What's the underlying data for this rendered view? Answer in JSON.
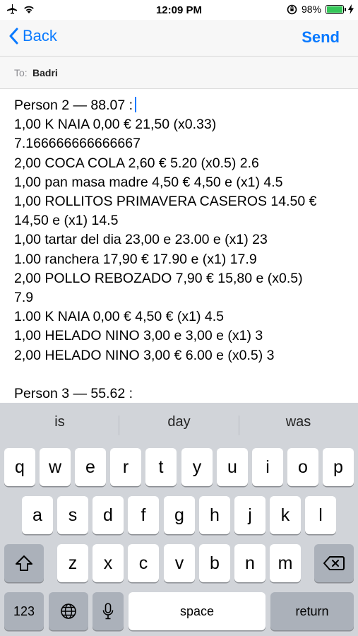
{
  "status_bar": {
    "time": "12:09 PM",
    "battery_percent": "98%",
    "battery_level": 0.98,
    "accent_color": "#35c759"
  },
  "nav": {
    "back_label": "Back",
    "send_label": "Send",
    "accent_color": "#0a7aff"
  },
  "recipient": {
    "label": "To:",
    "value": "Badri"
  },
  "body_lines": [
    "Person 2 — 88.07 :",
    "1,00 K NAIA 0,00 € 21,50 (x0.33)",
    "7.166666666666667",
    "2,00 COCA COLA 2,60 € 5.20 (x0.5) 2.6",
    "1,00 pan masa madre 4,50 € 4,50 e (x1) 4.5",
    "1,00 ROLLITOS PRIMAVERA CASEROS 14.50 €",
    "14,50 e (x1) 14.5",
    "1,00 tartar del dia 23,00 e 23.00 e (x1) 23",
    "1.00 ranchera 17,90 € 17.90 e (x1) 17.9",
    "2,00 POLLO REBOZADO 7,90 € 15,80 e (x0.5)",
    "7.9",
    "1.00 K NAIA 0,00 € 4,50 € (x1) 4.5",
    "1,00 HELADO NINO 3,00 e 3,00 e (x1) 3",
    "2,00 HELADO NINO 3,00 € 6.00 e (x0.5) 3",
    "",
    "Person 3 — 55.62 :"
  ],
  "keyboard": {
    "suggestions": [
      "is",
      "day",
      "was"
    ],
    "row1": [
      "q",
      "w",
      "e",
      "r",
      "t",
      "y",
      "u",
      "i",
      "o",
      "p"
    ],
    "row2": [
      "a",
      "s",
      "d",
      "f",
      "g",
      "h",
      "j",
      "k",
      "l"
    ],
    "row3": [
      "z",
      "x",
      "c",
      "v",
      "b",
      "n",
      "m"
    ],
    "numbers_label": "123",
    "space_label": "space",
    "return_label": "return"
  }
}
